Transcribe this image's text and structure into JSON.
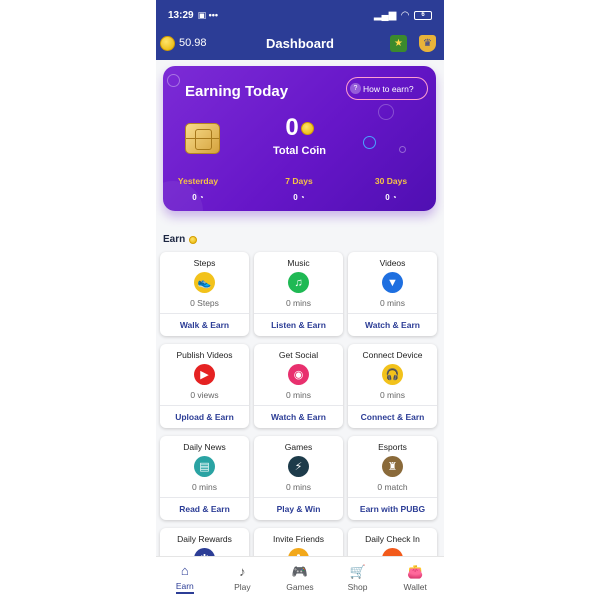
{
  "status_bar": {
    "time": "13:29",
    "battery": "6"
  },
  "header": {
    "balance": "50.98",
    "title": "Dashboard",
    "icons": [
      "badge-icon",
      "shield-icon"
    ]
  },
  "earning_card": {
    "title": "Earning Today",
    "help_button": "How to earn?",
    "help_icon": "?",
    "total_value": "0",
    "total_label": "Total Coin",
    "stats": [
      {
        "label": "Yesterday",
        "value": "0"
      },
      {
        "label": "7 Days",
        "value": "0"
      },
      {
        "label": "30 Days",
        "value": "0"
      }
    ]
  },
  "section": {
    "title": "Earn"
  },
  "tiles": [
    {
      "name": "Steps",
      "count": "0 Steps",
      "action": "Walk & Earn",
      "icon": "sneaker-icon",
      "color": "#f2c21b",
      "glyph": "👟"
    },
    {
      "name": "Music",
      "count": "0 mins",
      "action": "Listen & Earn",
      "icon": "music-icon",
      "color": "#1fb954",
      "glyph": "♫"
    },
    {
      "name": "Videos",
      "count": "0 mins",
      "action": "Watch & Earn",
      "icon": "video-icon",
      "color": "#1e6fe0",
      "glyph": "▼"
    },
    {
      "name": "Publish Videos",
      "count": "0 views",
      "action": "Upload & Earn",
      "icon": "youtube-icon",
      "color": "#e52222",
      "glyph": "▶"
    },
    {
      "name": "Get Social",
      "count": "0 mins",
      "action": "Watch & Earn",
      "icon": "instagram-icon",
      "color": "#e8306e",
      "glyph": "◉"
    },
    {
      "name": "Connect Device",
      "count": "0 mins",
      "action": "Connect & Earn",
      "icon": "headphones-icon",
      "color": "#f2c21b",
      "glyph": "🎧"
    },
    {
      "name": "Daily News",
      "count": "0 mins",
      "action": "Read & Earn",
      "icon": "newspaper-icon",
      "color": "#2aa3a3",
      "glyph": "▤"
    },
    {
      "name": "Games",
      "count": "0 mins",
      "action": "Play & Win",
      "icon": "lightning-icon",
      "color": "#1d3b4a",
      "glyph": "⚡"
    },
    {
      "name": "Esports",
      "count": "0 match",
      "action": "Earn with PUBG",
      "icon": "pubg-icon",
      "color": "#8a6a3a",
      "glyph": "♜"
    },
    {
      "name": "Daily Rewards",
      "count": "",
      "action": "",
      "icon": "puzzle-icon",
      "color": "#2c3d96",
      "glyph": "✱"
    },
    {
      "name": "Invite Friends",
      "count": "",
      "action": "",
      "icon": "invite-icon",
      "color": "#f2a81b",
      "glyph": "✿"
    },
    {
      "name": "Daily Check In",
      "count": "",
      "action": "",
      "icon": "checkin-icon",
      "color": "#f25a1b",
      "glyph": "●"
    }
  ],
  "bottom_nav": [
    {
      "label": "Earn",
      "icon": "home-icon",
      "glyph": "⌂",
      "active": true
    },
    {
      "label": "Play",
      "icon": "music-note-icon",
      "glyph": "♪",
      "active": false
    },
    {
      "label": "Games",
      "icon": "gamepad-icon",
      "glyph": "🎮",
      "active": false
    },
    {
      "label": "Shop",
      "icon": "cart-icon",
      "glyph": "🛒",
      "active": false
    },
    {
      "label": "Wallet",
      "icon": "wallet-icon",
      "glyph": "👛",
      "active": false
    }
  ],
  "colors": {
    "primary": "#2c3d96",
    "card_purple": "#6616c8",
    "gold": "#f6c445"
  }
}
